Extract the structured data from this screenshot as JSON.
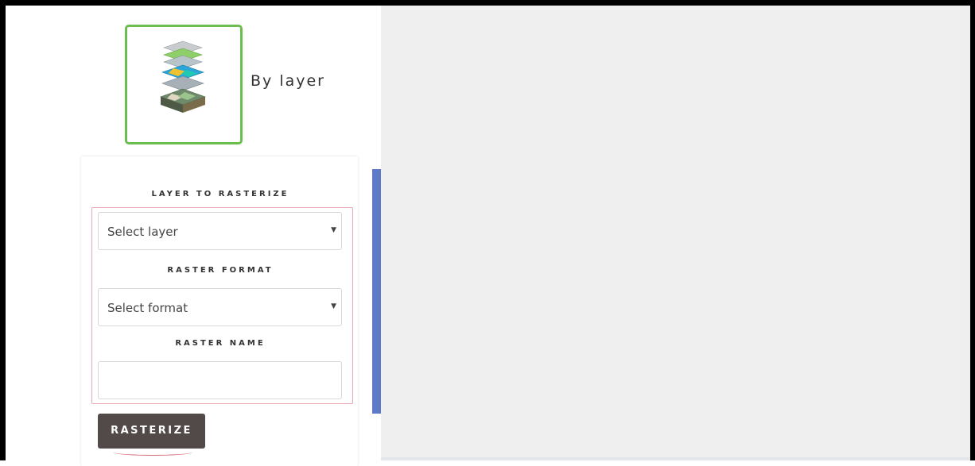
{
  "logo": {
    "icon": "layers-stack-icon",
    "caption": "By layer"
  },
  "form": {
    "layer_label": "LAYER TO RASTERIZE",
    "layer_select": {
      "value": "Select layer",
      "arrow": "▼"
    },
    "format_label": "RASTER FORMAT",
    "format_select": {
      "value": "Select format",
      "arrow": "▼"
    },
    "name_label": "RASTER NAME",
    "name_input": {
      "value": "",
      "placeholder": ""
    },
    "submit_label": "RASTERIZE"
  },
  "colors": {
    "logo_border": "#6cbd4f",
    "button_bg": "#524949",
    "scrollbar": "#5f79c9",
    "form_border": "#e7a8b3",
    "map_bg": "#efefef"
  }
}
